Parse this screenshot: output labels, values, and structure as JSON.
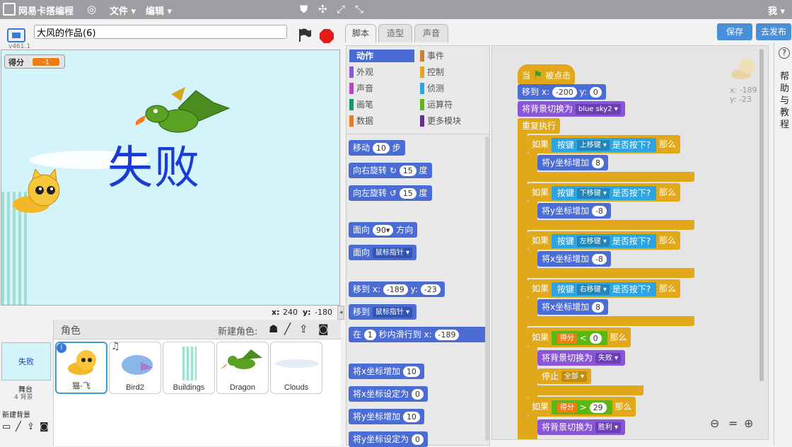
{
  "menubar": {
    "app_name": "网易卡搭编程",
    "file": "文件",
    "edit": "编辑",
    "user": "我"
  },
  "stage": {
    "version": "v461.1",
    "project_title": "大风的作品(6)",
    "score_label": "得分",
    "score_value": "-1",
    "fail_text": "失败",
    "x_label": "x:",
    "x_value": "240",
    "y_label": "y:",
    "y_value": "-180"
  },
  "sprites": {
    "header_label": "角色",
    "new_sprite_label": "新建角色:",
    "stage_thumb_text": "失败",
    "stage_label": "舞台",
    "stage_backdrops": "4 背景",
    "new_backdrop_label": "新建背景",
    "items": [
      {
        "name": "猫-飞"
      },
      {
        "name": "Bird2"
      },
      {
        "name": "Buildings"
      },
      {
        "name": "Dragon"
      },
      {
        "name": "Clouds"
      }
    ]
  },
  "tabs": [
    "脚本",
    "造型",
    "声音"
  ],
  "buttons": {
    "save": "保存",
    "publish": "去发布"
  },
  "categories": [
    {
      "label": "动作",
      "color": "#4a6cd4"
    },
    {
      "label": "事件",
      "color": "#c88330"
    },
    {
      "label": "外观",
      "color": "#8a55d7"
    },
    {
      "label": "控制",
      "color": "#e1a91a"
    },
    {
      "label": "声音",
      "color": "#bb42c3"
    },
    {
      "label": "侦测",
      "color": "#2ca5e2"
    },
    {
      "label": "画笔",
      "color": "#0e9a6c"
    },
    {
      "label": "运算符",
      "color": "#5cb712"
    },
    {
      "label": "数据",
      "color": "#ee7d16"
    },
    {
      "label": "更多模块",
      "color": "#632d99"
    }
  ],
  "palette": {
    "move": "移动",
    "move_val": "10",
    "steps": "步",
    "turn_right": "向右旋转",
    "turn_right_val": "15",
    "deg": "度",
    "turn_left": "向左旋转",
    "turn_left_val": "15",
    "point_dir": "面向",
    "point_dir_val": "90▾",
    "direction": "方向",
    "point_to": "面向",
    "mouse_ptr": "鼠标指针",
    "goto": "移到",
    "x": "x:",
    "goto_x": "-189",
    "y": "y:",
    "goto_y": "-23",
    "goto2": "移到",
    "glide": "在",
    "glide_secs": "1",
    "glide_mid": "秒内滑行到",
    "glide_x": "-189",
    "change_x": "将x坐标增加",
    "change_x_val": "10",
    "set_x": "将x坐标设定为",
    "set_x_val": "0",
    "change_y": "将y坐标增加",
    "change_y_val": "10",
    "set_y": "将y坐标设定为",
    "set_y_val": "0"
  },
  "script": {
    "hat_when": "当",
    "hat_clicked": "被点击",
    "goto": "移到",
    "x": "x:",
    "x_val": "-200",
    "y": "y:",
    "y_val": "0",
    "switch_bg": "将背景切换为",
    "bg_val": "blue sky2",
    "forever": "重复执行",
    "if": "如果",
    "key": "按键",
    "pressed": "是否按下?",
    "then": "那么",
    "key_up": "上移键",
    "key_down": "下移键",
    "key_left": "左移键",
    "key_right": "右移键",
    "change_y": "将y坐标增加",
    "change_x": "将x坐标增加",
    "val_8": "8",
    "val_neg8": "-8",
    "score": "得分",
    "lt": "<",
    "gt": ">",
    "zero": "0",
    "twenty_nine": "29",
    "bg_fail": "失败",
    "stop": "停止",
    "stop_all": "全部",
    "bg_win": "胜利",
    "sprite_x": "x: -189",
    "sprite_y": "y: -23"
  },
  "help": "帮助与教程"
}
